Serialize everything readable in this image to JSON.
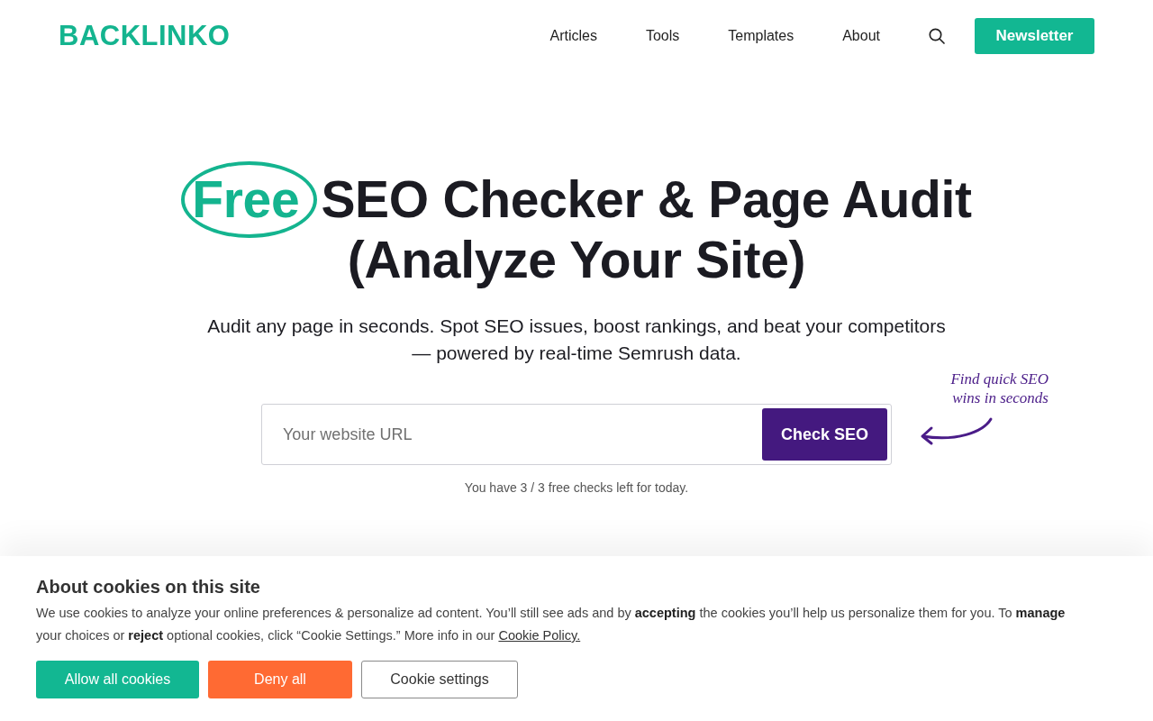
{
  "header": {
    "logo": "BACKLINKO",
    "nav": [
      {
        "label": "Articles"
      },
      {
        "label": "Tools"
      },
      {
        "label": "Templates"
      },
      {
        "label": "About"
      }
    ],
    "newsletter_button": "Newsletter"
  },
  "hero": {
    "title_highlight": "Free",
    "title": "SEO Checker & Page Audit (Analyze Your Site)",
    "subtitle": "Audit any page in seconds. Spot SEO issues, boost rankings, and beat your competitors — powered by real-time Semrush data.",
    "url_field": {
      "placeholder": "Your website URL"
    },
    "submit_button": "Check SEO",
    "annotation": "Find quick SEO wins in seconds",
    "checks_left": "You have 3 / 3 free checks left for today."
  },
  "cookie_banner": {
    "title": "About cookies on this site",
    "text": "We use cookies to analyze your online preferences & personalize ad content. You’ll still see ads and by **accepting** the cookies you’ll help us personalize them for you. To **manage** your choices or **reject** optional cookies, click “Cookie Settings.” More info in our",
    "policy_link": "Cookie Policy.",
    "buttons": [
      {
        "label": "Allow all cookies",
        "kind": "accept"
      },
      {
        "label": "Deny all",
        "kind": "deny"
      },
      {
        "label": "Cookie settings",
        "kind": "settings"
      }
    ]
  }
}
